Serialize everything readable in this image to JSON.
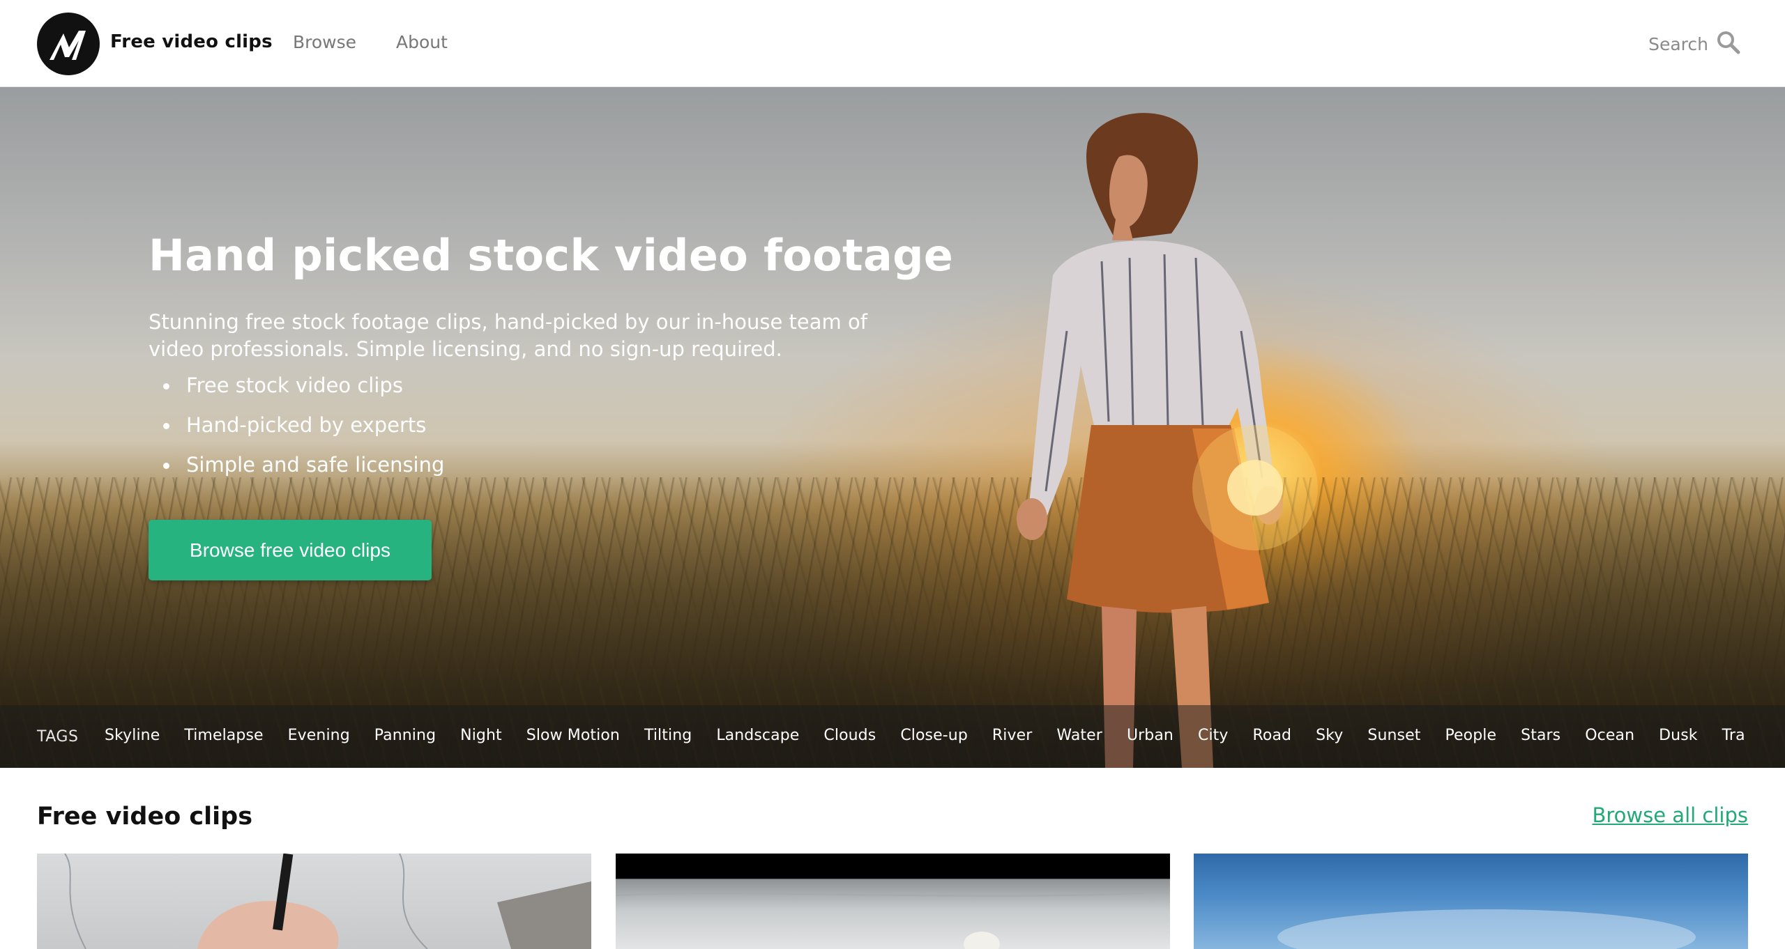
{
  "header": {
    "brand": "Free video clips",
    "nav": [
      {
        "label": "Browse"
      },
      {
        "label": "About"
      }
    ],
    "search": {
      "placeholder": "Search",
      "icon": "search-icon"
    },
    "logo_icon": "logo-icon"
  },
  "hero": {
    "title": "Hand picked stock video footage",
    "description": "Stunning free stock footage clips, hand-picked by our in-house team of video professionals. Simple licensing, and no sign-up required.",
    "bullets": [
      "Free stock video clips",
      "Hand-picked by experts",
      "Simple and safe licensing"
    ],
    "cta_label": "Browse free video clips",
    "cta_color": "#26b37f"
  },
  "tags": {
    "label": "TAGS",
    "items": [
      "Skyline",
      "Timelapse",
      "Evening",
      "Panning",
      "Night",
      "Slow Motion",
      "Tilting",
      "Landscape",
      "Clouds",
      "Close-up",
      "River",
      "Water",
      "Urban",
      "City",
      "Road",
      "Sky",
      "Sunset",
      "People",
      "Stars",
      "Ocean",
      "Dusk",
      "Tra"
    ]
  },
  "section": {
    "title": "Free video clips",
    "browse_all": "Browse all clips",
    "link_color": "#23a878"
  }
}
